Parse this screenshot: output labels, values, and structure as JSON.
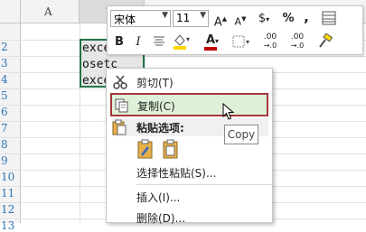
{
  "sheet": {
    "col_a": "A",
    "rows": [
      "2",
      "3",
      "4",
      "5",
      "6",
      "7",
      "8",
      "9",
      "10",
      "11",
      "12",
      "13"
    ],
    "cells": [
      "exce",
      "osetc",
      "exce"
    ]
  },
  "mini_toolbar": {
    "font_name": "宋体",
    "font_size": "11",
    "grow_font": "A",
    "shrink_font": "A",
    "currency": "$",
    "percent": "%",
    "comma": ",",
    "bold": "B",
    "italic": "I",
    "font_color_letter": "A",
    "increase_decimal": ".00",
    "decrease_decimal": ".00",
    "accent_red": "#c00000",
    "accent_yellow": "#ffd800"
  },
  "context_menu": {
    "cut": "剪切(T)",
    "copy": "复制(C)",
    "paste_options": "粘贴选项:",
    "paste_special": "选择性粘贴(S)...",
    "insert": "插入(I)...",
    "delete": "删除(D)..."
  },
  "tooltip": "Copy"
}
